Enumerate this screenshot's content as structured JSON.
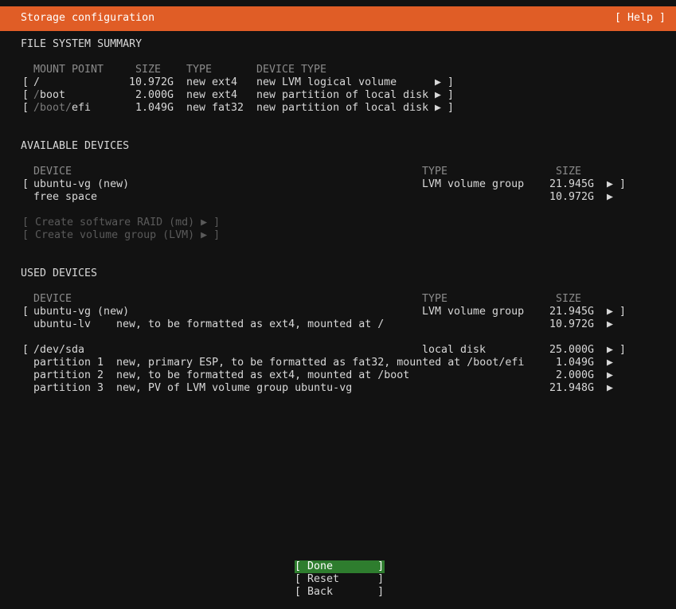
{
  "header": {
    "title": "Storage configuration",
    "help": "[ Help ]"
  },
  "fs_summary": {
    "heading": "FILE SYSTEM SUMMARY",
    "columns": [
      "MOUNT POINT",
      "SIZE",
      "TYPE",
      "DEVICE TYPE"
    ],
    "rows": [
      {
        "open": "[",
        "mount_prefix": "/",
        "mount_rest": "",
        "size": "10.972G",
        "type": "new ext4",
        "device_type": "new LVM logical volume",
        "arrow": "▶ ]"
      },
      {
        "open": "[",
        "mount_prefix": "/",
        "mount_rest": "boot",
        "size": "2.000G",
        "type": "new ext4",
        "device_type": "new partition of local disk",
        "arrow": "▶ ]"
      },
      {
        "open": "[",
        "mount_prefix": "/boot/",
        "mount_rest": "efi",
        "size": "1.049G",
        "type": "new fat32",
        "device_type": "new partition of local disk",
        "arrow": "▶ ]"
      }
    ]
  },
  "available": {
    "heading": "AVAILABLE DEVICES",
    "columns": [
      "DEVICE",
      "TYPE",
      "SIZE"
    ],
    "rows": [
      {
        "open": "[",
        "device": "ubuntu-vg (new)",
        "type": "LVM volume group",
        "size": "21.945G",
        "arrow": "▶ ]"
      },
      {
        "device": "free space",
        "size": "10.972G",
        "arrow": "▶"
      }
    ],
    "actions": [
      "[ Create software RAID (md) ▶ ]",
      "[ Create volume group (LVM) ▶ ]"
    ]
  },
  "used": {
    "heading": "USED DEVICES",
    "columns": [
      "DEVICE",
      "TYPE",
      "SIZE"
    ],
    "vg": {
      "open": "[",
      "device": "ubuntu-vg (new)",
      "type": "LVM volume group",
      "size": "21.945G",
      "arrow": "▶ ]"
    },
    "vg_children": [
      {
        "device": "ubuntu-lv",
        "desc": "new, to be formatted as ext4, mounted at /",
        "size": "10.972G",
        "arrow": "▶"
      }
    ],
    "disk": {
      "open": "[",
      "device": "/dev/sda",
      "type": "local disk",
      "size": "25.000G",
      "arrow": "▶ ]"
    },
    "disk_children": [
      {
        "device": "partition 1",
        "desc": "new, primary ESP, to be formatted as fat32, mounted at /boot/efi",
        "size": "1.049G",
        "arrow": "▶"
      },
      {
        "device": "partition 2",
        "desc": "new, to be formatted as ext4, mounted at /boot",
        "size": "2.000G",
        "arrow": "▶"
      },
      {
        "device": "partition 3",
        "desc": "new, PV of LVM volume group ubuntu-vg",
        "size": "21.948G",
        "arrow": "▶"
      }
    ]
  },
  "buttons": {
    "done": "[ Done       ]",
    "reset": "[ Reset      ]",
    "back": "[ Back       ]"
  },
  "colors": {
    "header_bg": "#e05d26",
    "selected_button_bg": "#2e7d2e",
    "background": "#121212"
  }
}
